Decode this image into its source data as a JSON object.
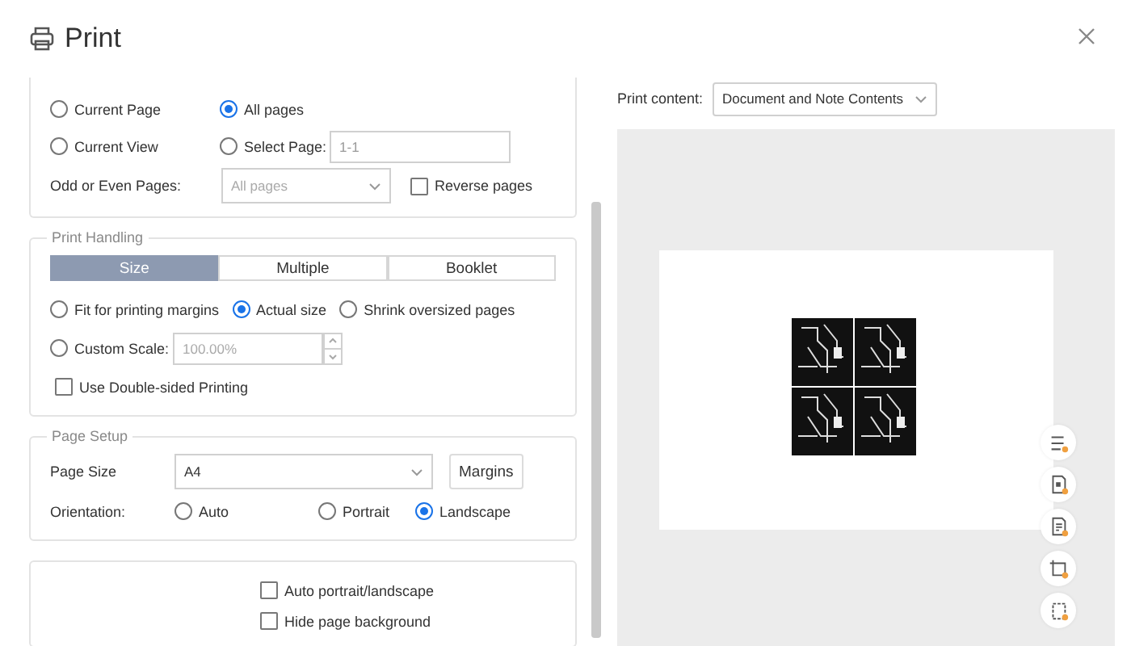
{
  "window": {
    "title": "Print"
  },
  "range": {
    "options": [
      {
        "label": "Current Page",
        "selected": false
      },
      {
        "label": "All pages",
        "selected": true
      },
      {
        "label": "Current View",
        "selected": false
      },
      {
        "label": "Select Page:",
        "selected": false
      }
    ],
    "page_field": {
      "value": "1-1"
    },
    "odd_even": {
      "label": "Odd or Even Pages:",
      "value": "All pages",
      "disabled": true
    },
    "reverse": {
      "label": "Reverse pages",
      "checked": false
    }
  },
  "print_handling": {
    "title": "Print Handling",
    "tabs": [
      {
        "label": "Size",
        "selected": true
      },
      {
        "label": "Multiple",
        "selected": false
      },
      {
        "label": "Booklet",
        "selected": false
      }
    ],
    "scale_options": [
      {
        "label": "Fit for printing margins",
        "selected": false
      },
      {
        "label": "Actual size",
        "selected": true
      },
      {
        "label": "Shrink oversized pages",
        "selected": false
      }
    ],
    "custom_scale": {
      "label": "Custom Scale:",
      "selected": false,
      "value": "100.00%",
      "disabled": true
    },
    "double_sided": {
      "label": "Use Double-sided Printing",
      "checked": false
    }
  },
  "page_setup": {
    "title": "Page Setup",
    "page_size": {
      "label": "Page Size",
      "value": "A4"
    },
    "margins_button": "Margins",
    "orientation": {
      "label": "Orientation:",
      "options": [
        {
          "label": "Auto",
          "selected": false
        },
        {
          "label": "Portrait",
          "selected": false
        },
        {
          "label": "Landscape",
          "selected": true
        }
      ]
    }
  },
  "options": [
    {
      "label": "Auto portrait/landscape",
      "checked": false
    },
    {
      "label": "Hide page background",
      "checked": false
    }
  ],
  "print_content": {
    "label": "Print content:",
    "value": "Document and Note Contents"
  }
}
